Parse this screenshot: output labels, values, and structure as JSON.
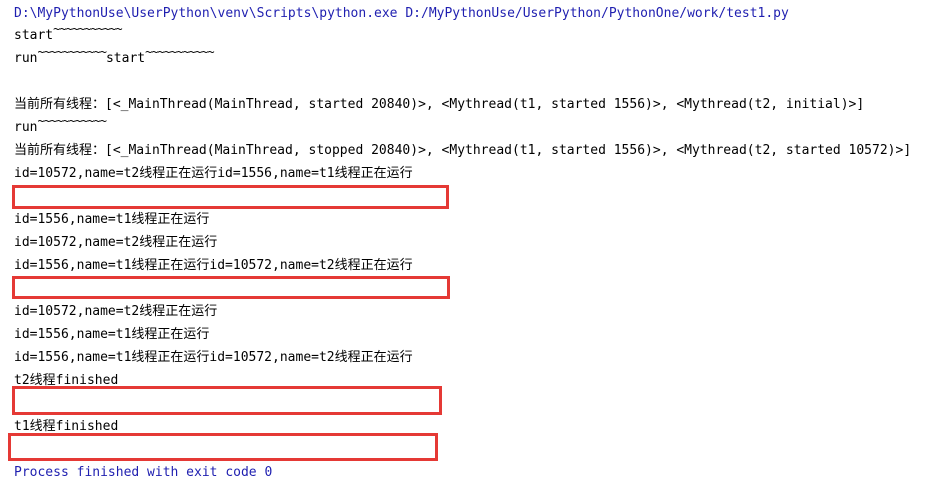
{
  "console": {
    "command": "D:\\MyPythonUse\\UserPython\\venv\\Scripts\\python.exe D:/MyPythonUse/UserPython/PythonOne/work/test1.py",
    "start_1": "start",
    "tilde_1": "~~~~~~~~~~~",
    "run_1": "run",
    "tilde_2": "~~~~~~~~~~~",
    "start_2": "start",
    "tilde_3": "~~~~~~~~~~~",
    "threads_1": "当前所有线程：[<_MainThread(MainThread, started 20840)>, <Mythread(t1, started 1556)>, <Mythread(t2, initial)>]",
    "run_2": "run",
    "tilde_4": "~~~~~~~~~~~",
    "threads_2": "当前所有线程：[<_MainThread(MainThread, stopped 20840)>, <Mythread(t1, started 1556)>, <Mythread(t2, started 10572)>]",
    "output_1": "id=10572,name=t2线程正在运行id=1556,name=t1线程正在运行",
    "output_2": "id=1556,name=t1线程正在运行",
    "output_3": "id=10572,name=t2线程正在运行",
    "output_4": "id=1556,name=t1线程正在运行id=10572,name=t2线程正在运行",
    "output_5": "id=10572,name=t2线程正在运行",
    "output_6": "id=1556,name=t1线程正在运行",
    "output_7": "id=1556,name=t1线程正在运行id=10572,name=t2线程正在运行",
    "finished_t2": "t2线程finished",
    "finished_t1": "t1线程finished",
    "exit": "Process finished with exit code 0"
  },
  "colors": {
    "command_text": "#1f1fb0",
    "highlight_box": "#e53935",
    "output_text": "#000000",
    "background": "#ffffff"
  }
}
